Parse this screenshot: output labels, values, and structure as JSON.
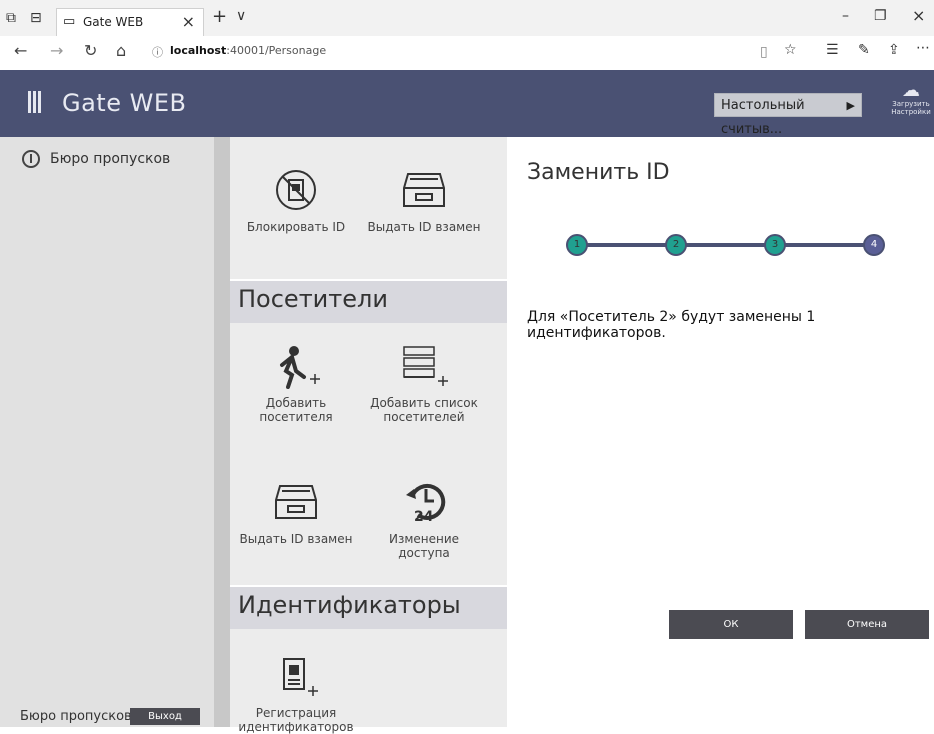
{
  "browser": {
    "tab_title": "Gate WEB",
    "tab_close": "×",
    "new_tab": "+",
    "tab_menu": "∨",
    "url_host": "localhost",
    "url_path": ":40001/Personage",
    "minimize": "–",
    "maximize": "❐",
    "close": "×"
  },
  "header": {
    "app_title": "Gate WEB",
    "reader_button": "Настольный считыв...",
    "upload_label_1": "Загрузить",
    "upload_label_2": "Настройки"
  },
  "sidebar": {
    "item_label": "Бюро пропусков",
    "footer_label": "Бюро пропусков",
    "exit_button": "Выход"
  },
  "tiles": {
    "block_id": "Блокировать ID",
    "issue_id_replace_1": "Выдать ID взамен",
    "section_visitors": "Посетители",
    "add_visitor": "Добавить посетителя",
    "add_visitor_list": "Добавить список посетителей",
    "issue_id_replace_2": "Выдать ID взамен",
    "change_access": "Изменение доступа",
    "section_identifiers": "Идентификаторы",
    "register_ids": "Регистрация идентификаторов"
  },
  "dialog": {
    "title": "Заменить ID",
    "steps": [
      "1",
      "2",
      "3",
      "4"
    ],
    "message": "Для «Посетитель 2» будут заменены 1 идентификаторов.",
    "ok_button": "ОК",
    "cancel_button": "Отмена"
  },
  "colors": {
    "header_bg": "#4a5173",
    "step_done": "#20a090",
    "step_current": "#5a5f96",
    "button_bg": "#4b4b52"
  }
}
